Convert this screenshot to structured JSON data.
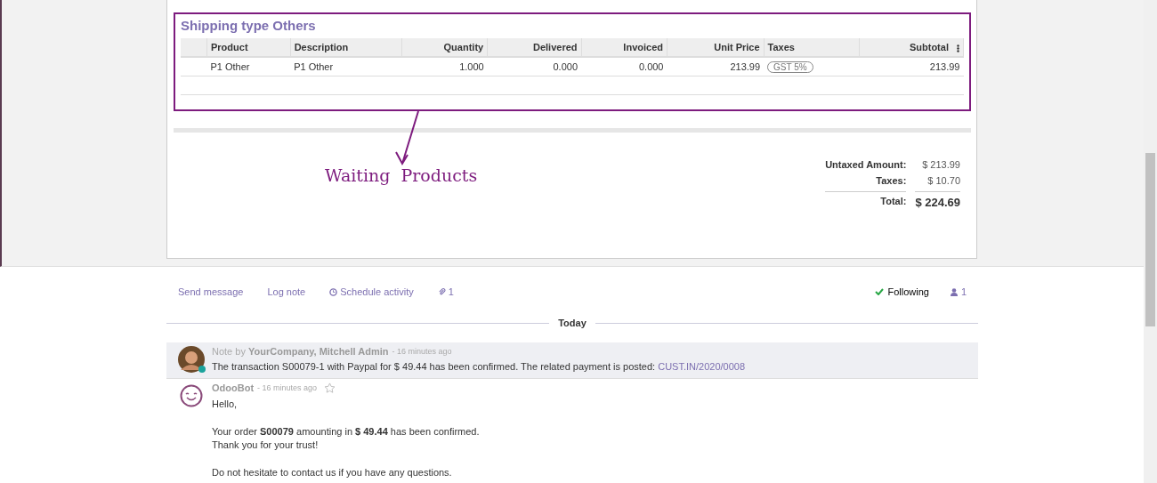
{
  "section": {
    "title": "Shipping type Others",
    "columns": [
      "Product",
      "Description",
      "Quantity",
      "Delivered",
      "Invoiced",
      "Unit Price",
      "Taxes",
      "Subtotal"
    ],
    "rows": [
      {
        "cells": [
          "P1 Other",
          "P1 Other",
          "1.000",
          "0.000",
          "0.000",
          "213.99",
          {
            "tag": "GST 5%"
          },
          "213.99"
        ]
      }
    ]
  },
  "annotation": {
    "label": "Waiting  Products"
  },
  "totals": [
    {
      "label": "Untaxed Amount:",
      "value": "$ 213.99",
      "kind": "normal"
    },
    {
      "label": "Taxes:",
      "value": "$ 10.70",
      "kind": "normal"
    },
    {
      "label": "Total:",
      "value": "$ 224.69",
      "kind": "grand"
    }
  ],
  "chatter": {
    "actions": [
      {
        "label": "Send message",
        "kind": "text"
      },
      {
        "label": "Log note",
        "kind": "text"
      },
      {
        "label": "Schedule activity",
        "kind": "clock"
      },
      {
        "label": "1",
        "kind": "clip"
      }
    ],
    "following": {
      "label": "Following",
      "on": true
    },
    "followers": "1",
    "separator": "Today",
    "messages": [
      {
        "kind": "note",
        "prefix": "Note by",
        "author": "YourCompany, Mitchell Admin",
        "time": "- 16 minutes ago",
        "online": true,
        "highlighted": true,
        "paragraphs": [
          [
            "The transaction S00079-1 with Paypal for $ 49.44 has been confirmed. The related payment is posted:"
          ]
        ],
        "link": "CUST.IN/2020/0008"
      },
      {
        "kind": "bot",
        "author": "OdooBot",
        "time": "- 16 minutes ago",
        "starred": false,
        "highlighted": false,
        "paragraphs": [
          [
            "Hello,"
          ],
          [
            "Your order **S00079** amounting in **$ 49.44** has been confirmed.",
            "Thank you for your trust!"
          ],
          [
            "Do not hesitate to contact us if you have any questions."
          ]
        ]
      }
    ]
  }
}
